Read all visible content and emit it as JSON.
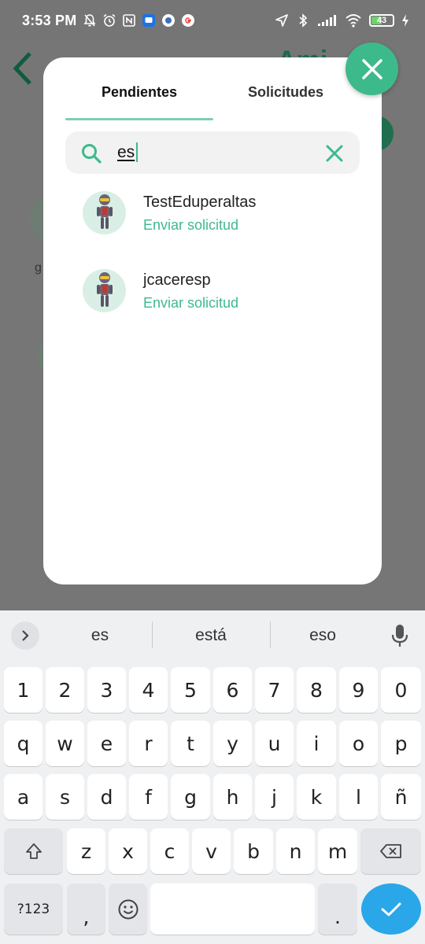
{
  "status_bar": {
    "time": "3:53 PM",
    "left_icons": [
      "alarm-off-icon",
      "alarm-clock-icon",
      "nfc-icon",
      "messages-icon",
      "app-icon",
      "google-icon"
    ],
    "right_icons": [
      "location-icon",
      "bluetooth-icon",
      "signal-icon",
      "wifi-icon"
    ],
    "battery": "43",
    "charging_icon": "bolt-icon"
  },
  "background": {
    "title_fragment": "Ami",
    "fragment_left": "g"
  },
  "modal": {
    "tabs": [
      {
        "label": "Pendientes",
        "active": true
      },
      {
        "label": "Solicitudes",
        "active": false
      }
    ],
    "search": {
      "value": "es",
      "placeholder": ""
    },
    "results": [
      {
        "username": "TestEduperaltas",
        "action": "Enviar solicitud",
        "avatar": "robot-avatar-icon"
      },
      {
        "username": "jcaceresp",
        "action": "Enviar solicitud",
        "avatar": "robot-avatar-icon"
      }
    ]
  },
  "keyboard": {
    "suggestions": [
      "es",
      "está",
      "eso"
    ],
    "rows": [
      [
        "1",
        "2",
        "3",
        "4",
        "5",
        "6",
        "7",
        "8",
        "9",
        "0"
      ],
      [
        "q",
        "w",
        "e",
        "r",
        "t",
        "y",
        "u",
        "i",
        "o",
        "p"
      ],
      [
        "a",
        "s",
        "d",
        "f",
        "g",
        "h",
        "j",
        "k",
        "l",
        "ñ"
      ],
      [
        "z",
        "x",
        "c",
        "v",
        "b",
        "n",
        "m"
      ]
    ],
    "symbols_label": "?123",
    "comma": ",",
    "period": "."
  },
  "colors": {
    "accent": "#3dba8c",
    "tab_underline": "#7dcfb0",
    "overlay": "#767676",
    "enter_key": "#2aa7e8"
  }
}
